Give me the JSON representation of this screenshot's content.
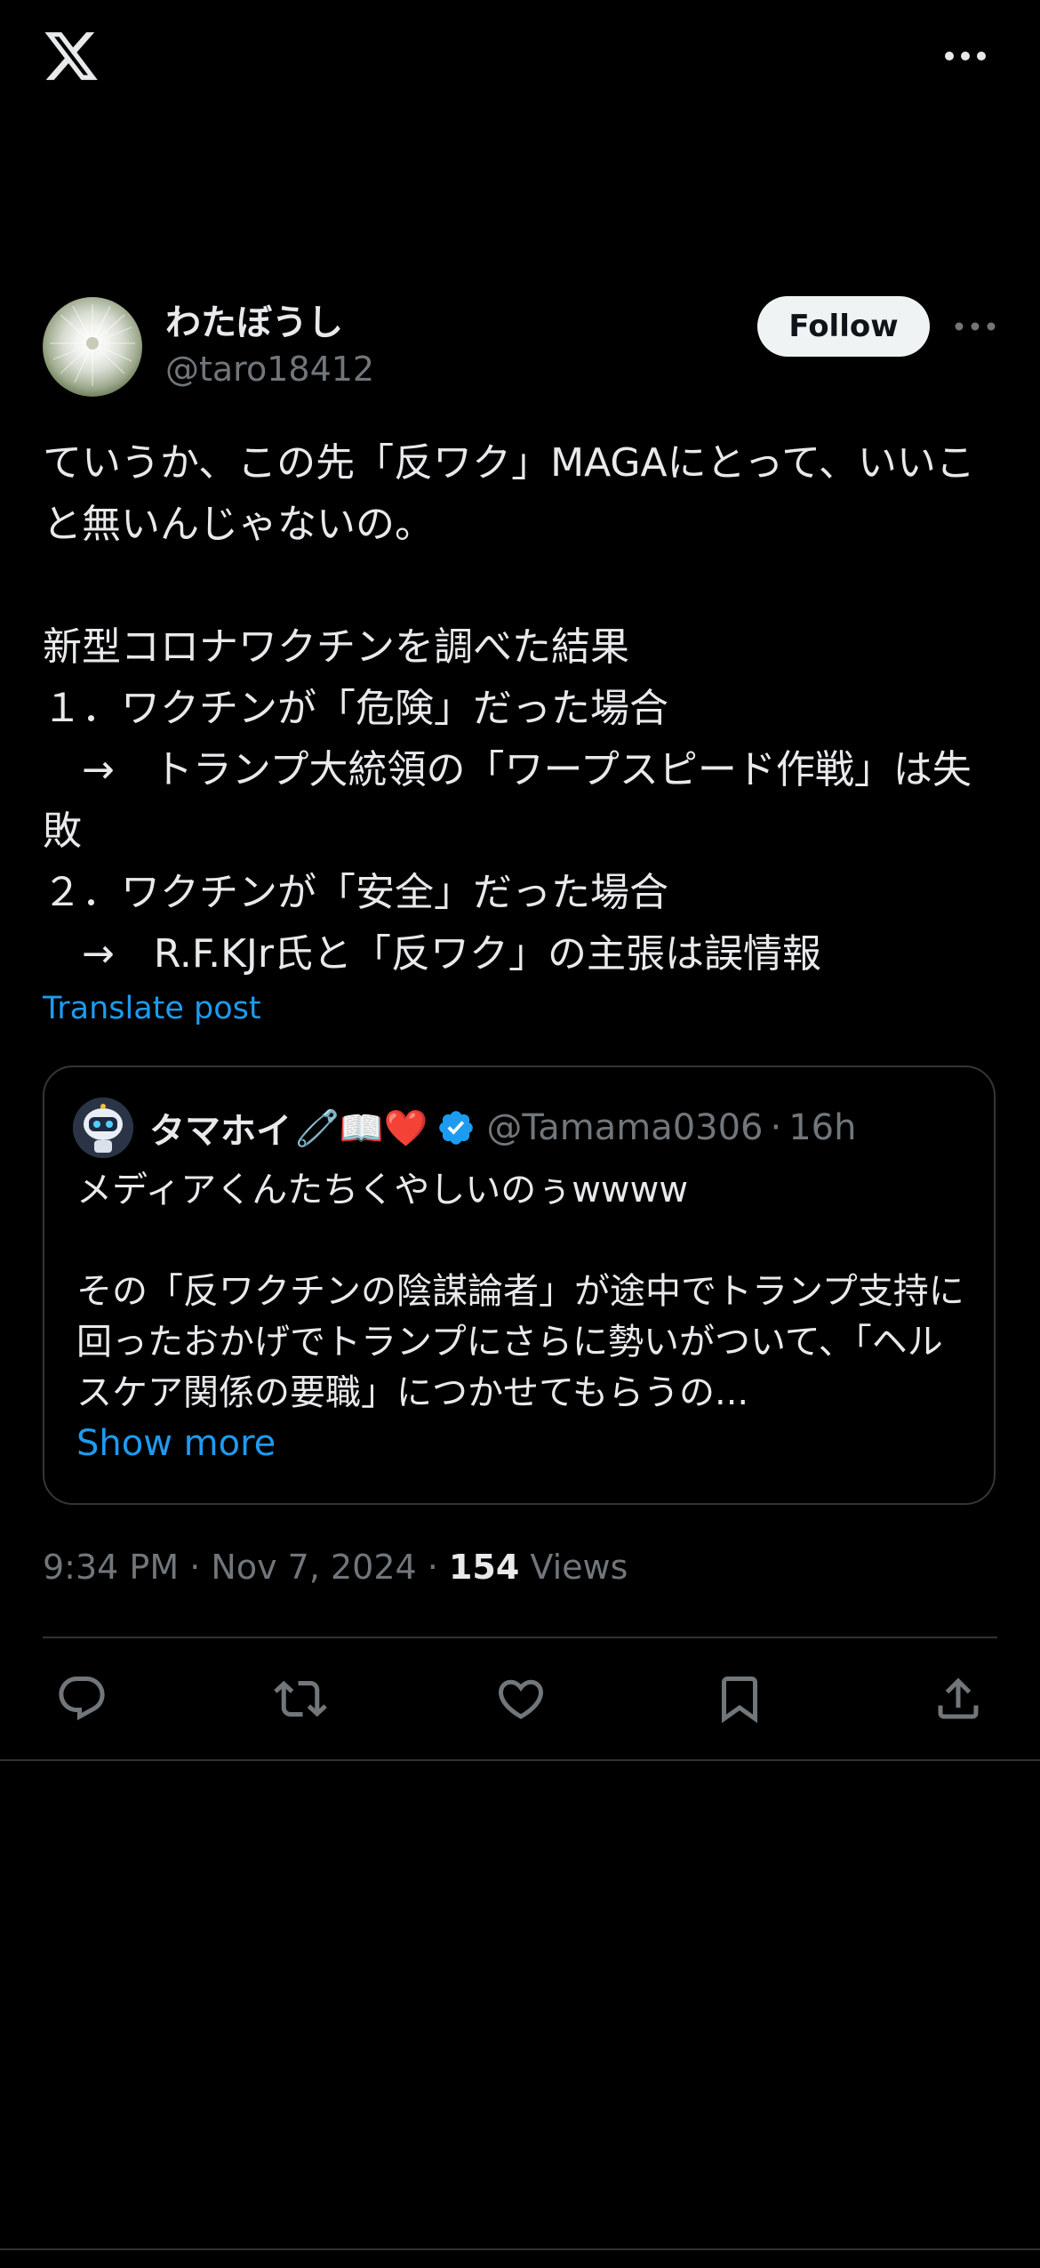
{
  "topbar": {
    "logo_icon": "x-logo-icon",
    "more_icon": "more-horizontal-icon"
  },
  "post": {
    "author_name": "わたぼうし",
    "author_handle": "@taro18412",
    "follow_label": "Follow",
    "text": "ていうか、この先「反ワク」MAGAにとって、いいこと無いんじゃないの。\n\n新型コロナワクチンを調べた結果\n１．ワクチンが「危険」だった場合\n　→　トランプ大統領の「ワープスピード作戦」は失敗\n２．ワクチンが「安全」だった場合\n　→　R.F.KJr氏と「反ワク」の主張は誤情報",
    "translate_label": "Translate post"
  },
  "quote": {
    "author_name": "タマホイ",
    "emojis": "🧷📖❤️",
    "handle": "@Tamama0306",
    "separator": "·",
    "time": "16h",
    "text": "メディアくんたちくやしいのぅwwww\n\nその「反ワクチンの陰謀論者」が途中でトランプ支持に回ったおかげでトランプにさらに勢いがついて、「ヘルスケア関係の要職」につかせてもらうの...",
    "show_more_label": "Show more"
  },
  "meta": {
    "time": "9:34 PM",
    "date": "Nov 7, 2024",
    "separator": "·",
    "views_count": "154",
    "views_label": "Views"
  },
  "actions": [
    "reply-icon",
    "repost-icon",
    "like-icon",
    "bookmark-icon",
    "share-icon"
  ],
  "colors": {
    "background": "#000000",
    "text": "#e7e9ea",
    "secondary": "#71767b",
    "accent": "#1d9bf0",
    "border": "#2f3336"
  }
}
